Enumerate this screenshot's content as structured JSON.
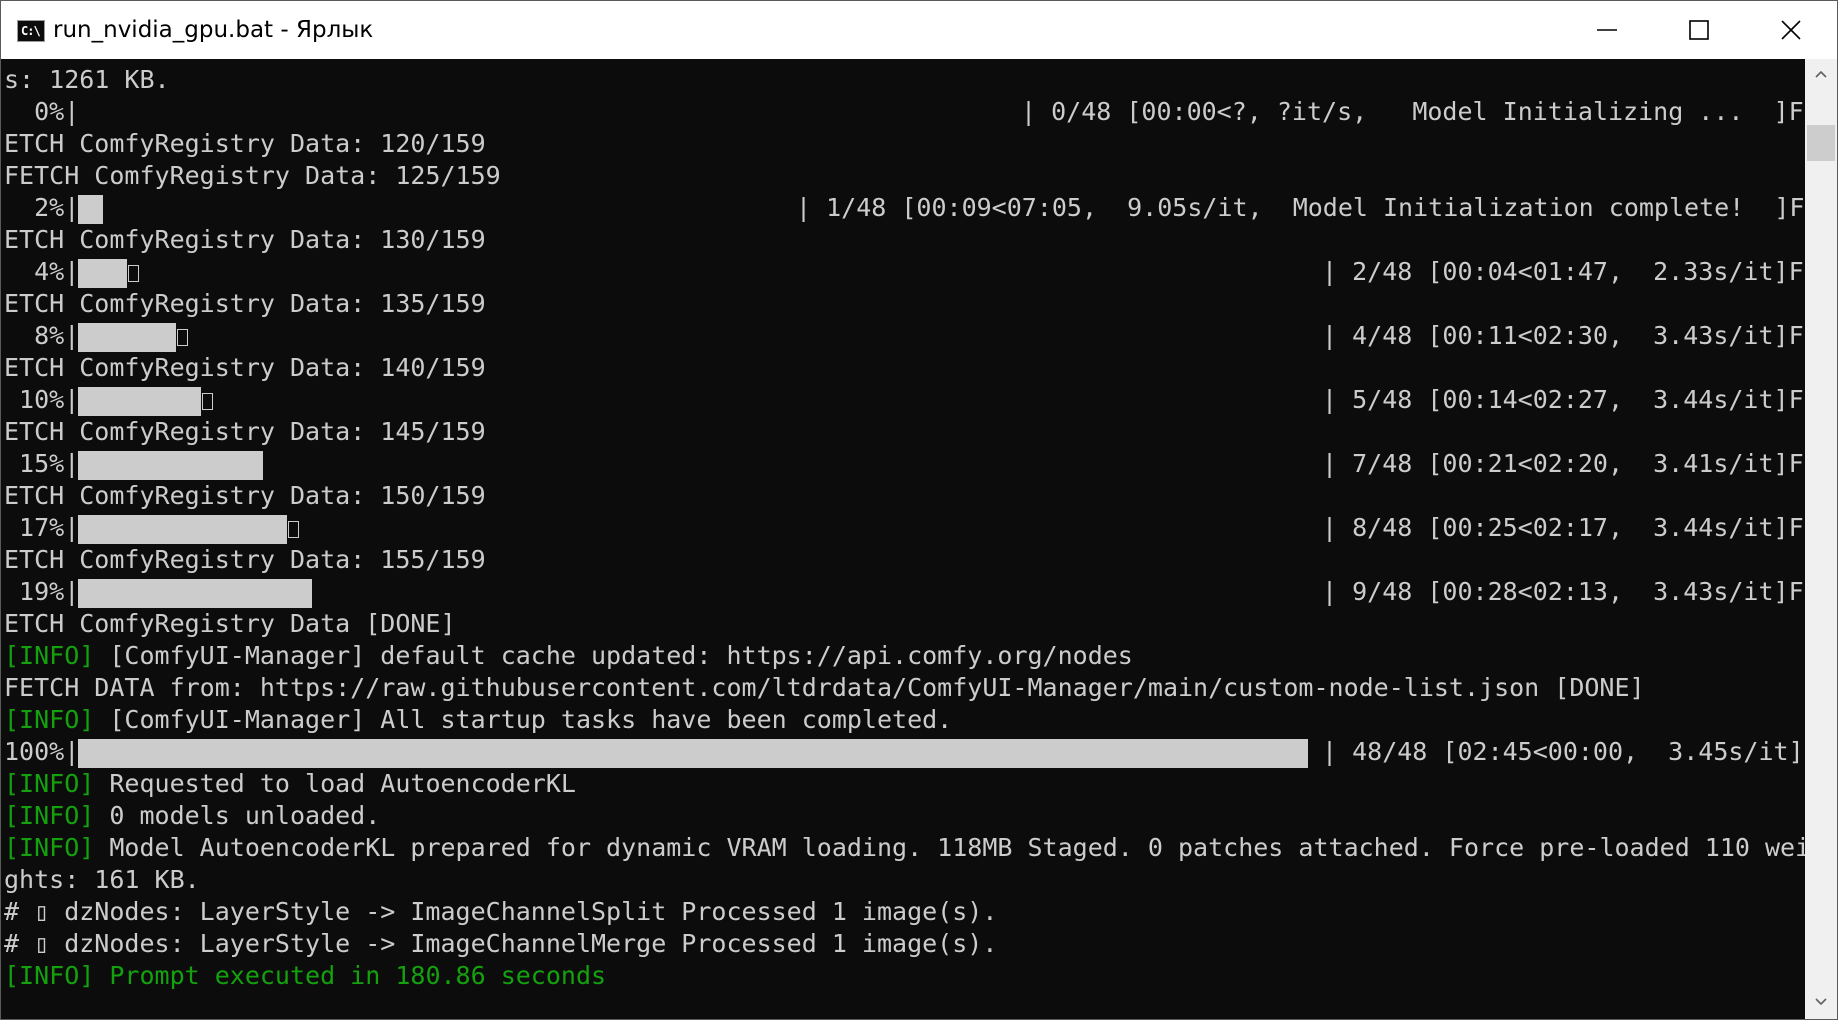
{
  "window": {
    "title": "run_nvidia_gpu.bat - Ярлык",
    "icon_text": "C:\\",
    "controls": [
      "minimize-icon",
      "maximize-icon",
      "close-icon"
    ]
  },
  "colors": {
    "console_bg": "#0c0c0c",
    "text": "#cccccc",
    "info_green": "#13a10e",
    "titlebar_bg": "#ffffff"
  },
  "console": {
    "lines": [
      {
        "text": "s: 1261 KB."
      },
      {
        "kind": "progress",
        "pct": "  0%|",
        "fill": 0,
        "stat": "| 0/48 [00:00<?, ?it/s,   Model Initializing ...  ]F"
      },
      {
        "text": "ETCH ComfyRegistry Data: 120/159"
      },
      {
        "text": "FETCH ComfyRegistry Data: 125/159"
      },
      {
        "kind": "progress",
        "pct": "  2%|",
        "fill": 0.02,
        "stat": "| 1/48 [00:09<07:05,  9.05s/it,  Model Initialization complete!  ]F"
      },
      {
        "text": "ETCH ComfyRegistry Data: 130/159"
      },
      {
        "kind": "progress",
        "pct": "  4%|",
        "fill": 0.04,
        "stat": "| 2/48 [00:04<01:47,  2.33s/it]F"
      },
      {
        "text": "ETCH ComfyRegistry Data: 135/159"
      },
      {
        "kind": "progress",
        "pct": "  8%|",
        "fill": 0.08,
        "stat": "| 4/48 [00:11<02:30,  3.43s/it]F"
      },
      {
        "text": "ETCH ComfyRegistry Data: 140/159"
      },
      {
        "kind": "progress",
        "pct": " 10%|",
        "fill": 0.1,
        "stat": "| 5/48 [00:14<02:27,  3.44s/it]F"
      },
      {
        "text": "ETCH ComfyRegistry Data: 145/159"
      },
      {
        "kind": "progress",
        "pct": " 15%|",
        "fill": 0.15,
        "stat": "| 7/48 [00:21<02:20,  3.41s/it]F"
      },
      {
        "text": "ETCH ComfyRegistry Data: 150/159"
      },
      {
        "kind": "progress",
        "pct": " 17%|",
        "fill": 0.17,
        "stat": "| 8/48 [00:25<02:17,  3.44s/it]F"
      },
      {
        "text": "ETCH ComfyRegistry Data: 155/159"
      },
      {
        "kind": "progress",
        "pct": " 19%|",
        "fill": 0.19,
        "stat": "| 9/48 [00:28<02:13,  3.43s/it]F"
      },
      {
        "text": "ETCH ComfyRegistry Data [DONE]"
      },
      {
        "tag": "[INFO]",
        "text": " [ComfyUI-Manager] default cache updated: https://api.comfy.org/nodes"
      },
      {
        "text": "FETCH DATA from: https://raw.githubusercontent.com/ltdrdata/ComfyUI-Manager/main/custom-node-list.json [DONE]"
      },
      {
        "tag": "[INFO]",
        "text": " [ComfyUI-Manager] All startup tasks have been completed."
      },
      {
        "kind": "progress",
        "pct": "100%|",
        "fill": 1.0,
        "stat": "| 48/48 [02:45<00:00,  3.45s/it]"
      },
      {
        "tag": "[INFO]",
        "text": " Requested to load AutoencoderKL"
      },
      {
        "tag": "[INFO]",
        "text": " 0 models unloaded."
      },
      {
        "tag": "[INFO]",
        "text": " Model AutoencoderKL prepared for dynamic VRAM loading. 118MB Staged. 0 patches attached. Force pre-loaded 110 wei"
      },
      {
        "text": "ghts: 161 KB."
      },
      {
        "text": "# ▯ dzNodes: LayerStyle -> ImageChannelSplit Processed 1 image(s)."
      },
      {
        "text": "# ▯ dzNodes: LayerStyle -> ImageChannelMerge Processed 1 image(s)."
      },
      {
        "tag": "[INFO]",
        "text": " Prompt executed in 180.86 seconds",
        "all_green": true
      }
    ]
  },
  "scrollbar": {
    "up": "scroll-up-arrow-icon",
    "down": "scroll-down-arrow-icon",
    "position": 0.07
  }
}
